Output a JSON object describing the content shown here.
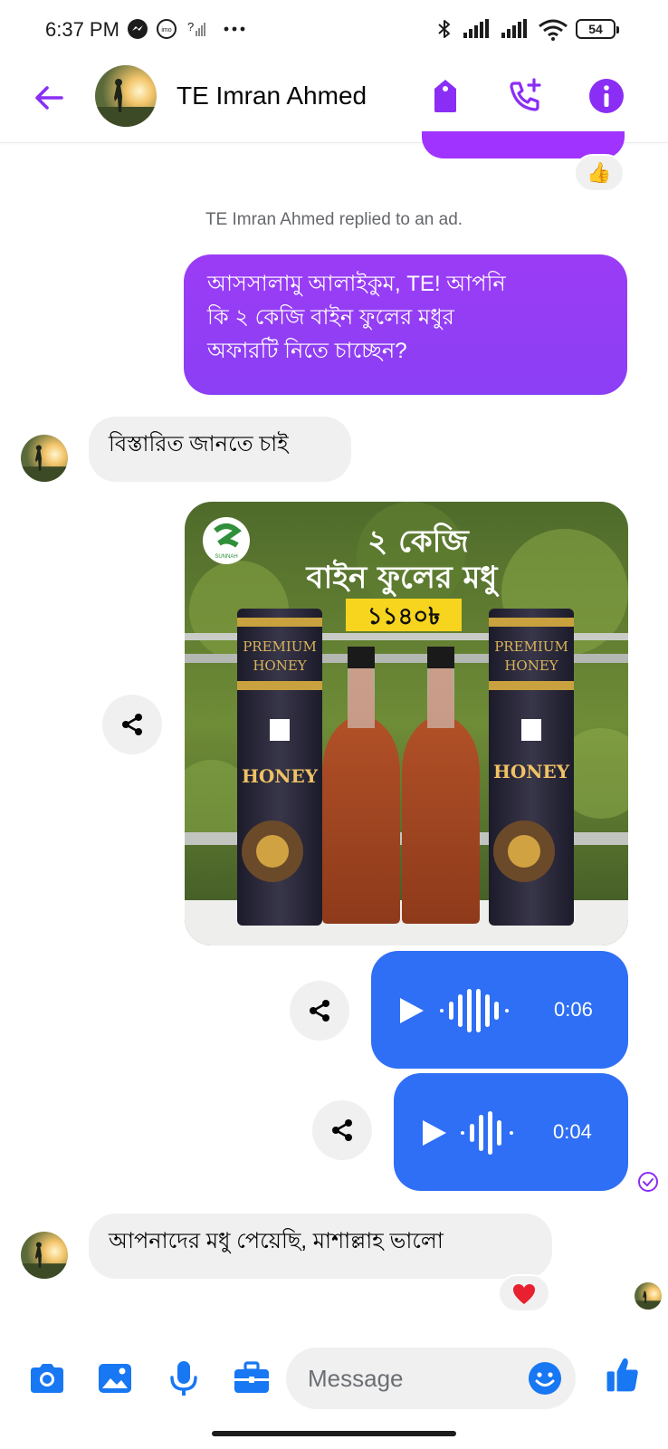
{
  "status_bar": {
    "time": "6:37 PM",
    "battery": "54",
    "icons": [
      "messenger-icon",
      "imo-icon",
      "no-signal-icon",
      "more-dots-icon",
      "bluetooth-icon",
      "signal-icon",
      "signal-icon",
      "wifi-icon",
      "battery-icon"
    ]
  },
  "header": {
    "title": "TE Imran Ahmed",
    "icons": [
      "back-arrow-icon",
      "tag-icon",
      "add-call-icon",
      "info-icon"
    ],
    "accent_color": "#8a2ef5"
  },
  "chat": {
    "top_reaction": "👍",
    "system_note": "TE Imran Ahmed replied to an ad.",
    "messages": [
      {
        "direction": "out",
        "text_lines": [
          "আসসালামু আলাইকুম, TE! আপনি",
          "কি ২ কেজি বাইন ফুলের মধুর",
          "অফারটি নিতে চাচ্ছেন?"
        ]
      },
      {
        "direction": "in",
        "text": "বিস্তারিত জানতে চাই"
      },
      {
        "direction": "out",
        "type": "image",
        "ad": {
          "headline_1": "২ কেজি",
          "headline_2": "বাইন ফুলের মধু",
          "price": "১১৪০৳",
          "jar_label_1": "PREMIUM",
          "jar_label_2": "HONEY",
          "jar_brand": "HONEY",
          "logo_text": "SUNNAH"
        }
      },
      {
        "direction": "out",
        "type": "voice",
        "duration": "0:06"
      },
      {
        "direction": "out",
        "type": "voice",
        "duration": "0:04"
      },
      {
        "direction": "in",
        "text": "আপনাদের মধু পেয়েছি, মাশাল্লাহ ভালো",
        "reaction": "❤️"
      }
    ]
  },
  "composer": {
    "placeholder": "Message",
    "icons": [
      "camera-icon",
      "gallery-icon",
      "microphone-icon",
      "toolbox-icon",
      "emoji-icon",
      "thumbs-up-icon"
    ]
  },
  "colors": {
    "outgoing_bubble": "#9038f5",
    "voice_bubble": "#2e6ff5",
    "incoming_bubble": "#f0f0f0",
    "icon_blue": "#1877f2",
    "accent_purple": "#8a2ef5"
  }
}
